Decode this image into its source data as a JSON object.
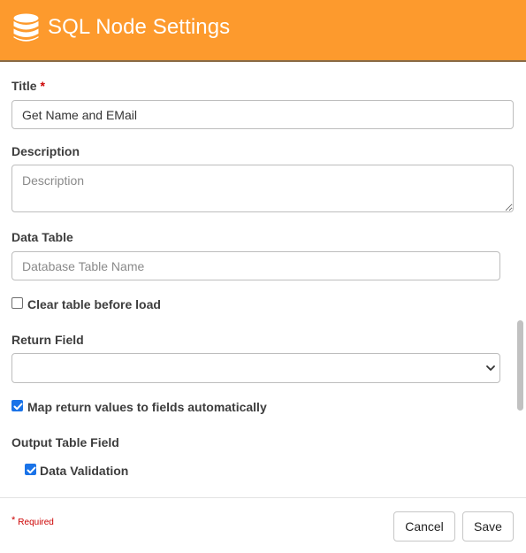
{
  "header": {
    "title": "SQL Node Settings",
    "icon": "database-icon",
    "color": "#fd9a2d"
  },
  "form": {
    "title_label": "Title",
    "required_mark": "*",
    "title_value": "Get Name and EMail",
    "description_label": "Description",
    "description_placeholder": "Description",
    "data_table_label": "Data Table",
    "data_table_placeholder": "Database Table Name",
    "clear_table_label": "Clear table before load",
    "clear_table_checked": false,
    "return_field_label": "Return Field",
    "return_field_value": "",
    "map_return_label": "Map return values to fields automatically",
    "map_return_checked": true,
    "output_table_label": "Output Table Field",
    "data_validation_label": "Data Validation",
    "data_validation_checked": true
  },
  "footer": {
    "required_star": "*",
    "required_text": "Required",
    "cancel_label": "Cancel",
    "save_label": "Save"
  },
  "colors": {
    "accent": "#fd9a2d",
    "checkbox": "#1a73e8",
    "required": "#cc0000"
  }
}
